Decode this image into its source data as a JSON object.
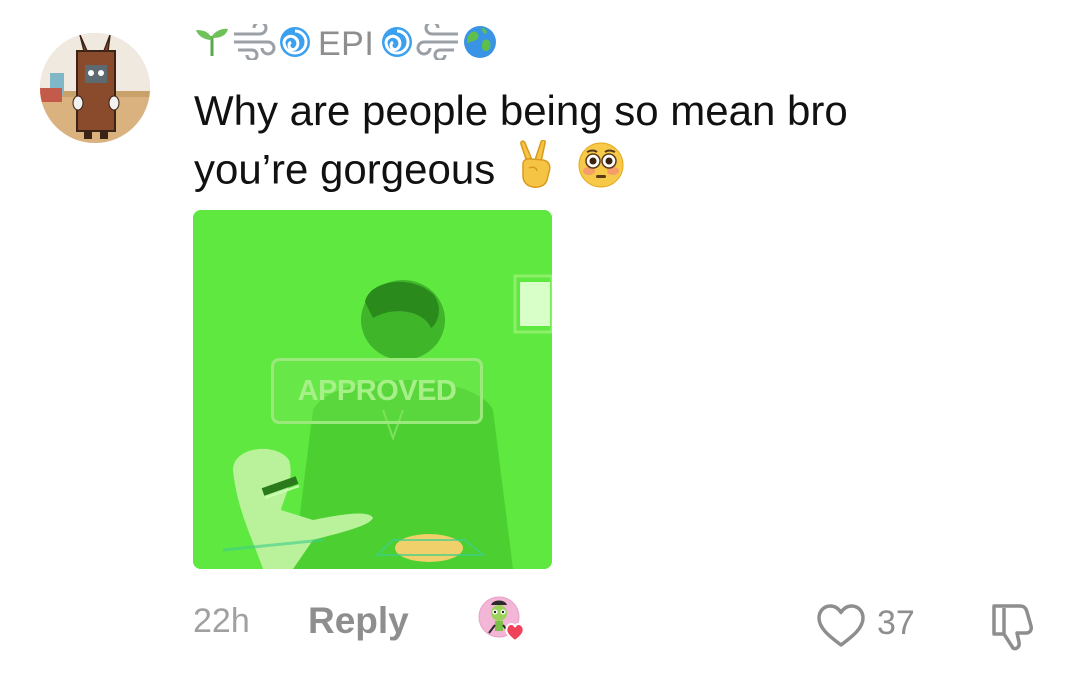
{
  "comment": {
    "username": "EPI",
    "username_decor_left": [
      "sprout-icon",
      "wind-icon",
      "cyclone-icon"
    ],
    "username_decor_right": [
      "cyclone-icon",
      "wind-icon",
      "globe-icon"
    ],
    "text_line1": "Why are people being so mean bro",
    "text_line2": "you’re gorgeous",
    "text_emojis": [
      "victory-hand-icon",
      "flushed-face-icon"
    ],
    "attachment": {
      "stamp_text": "APPROVED",
      "tint_color": "#5fe83f"
    },
    "timestamp": "22h",
    "reply_label": "Reply",
    "like_count": "37",
    "liked_by_creator": true
  },
  "colors": {
    "text_primary": "#111111",
    "text_secondary": "#8e8e8e",
    "heart_red": "#f0435a"
  }
}
